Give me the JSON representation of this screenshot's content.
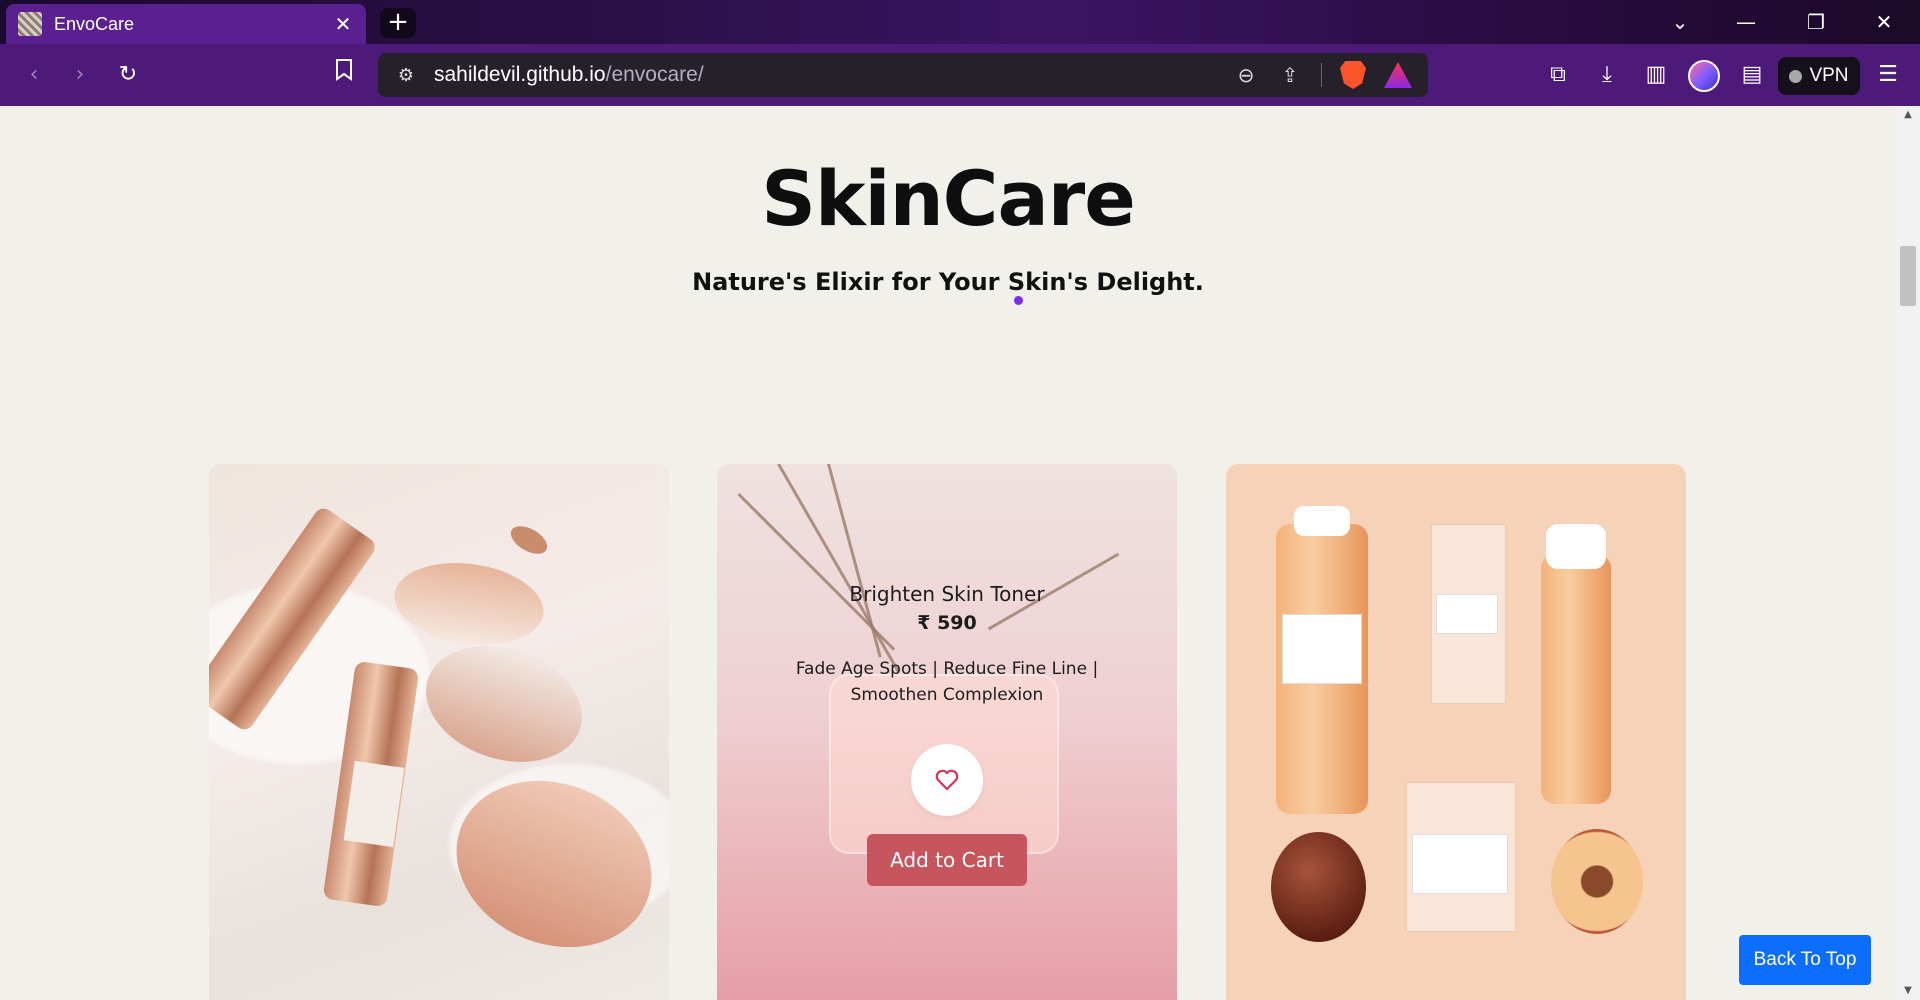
{
  "browser": {
    "tab_title": "EnvoCare",
    "url_domain": "sahildevil.github.io",
    "url_path": "/envocare/",
    "vpn_label": "VPN"
  },
  "page": {
    "heading": "SkinCare",
    "subheading": "Nature's Elixir for Your Skin's Delight.",
    "products": [
      {
        "name": "Brighten Skin Toner",
        "price": "₹ 590",
        "description": "Fade Age Spots | Reduce Fine Line | Smoothen Complexion",
        "add_to_cart": "Add to Cart"
      }
    ],
    "back_to_top": "Back To Top"
  },
  "colors": {
    "accent_purple": "#4d1a7a",
    "cart_button": "#c7555d",
    "back_to_top": "#0d6efd",
    "page_background": "#f2f0ea"
  },
  "icons": [
    "back-icon",
    "forward-icon",
    "reload-icon",
    "bookmark-icon",
    "site-settings-icon",
    "zoom-icon",
    "share-icon",
    "brave-shield-icon",
    "rewards-icon",
    "extensions-icon",
    "download-icon",
    "sidebar-icon",
    "wallet-icon",
    "menu-icon",
    "heart-icon"
  ]
}
